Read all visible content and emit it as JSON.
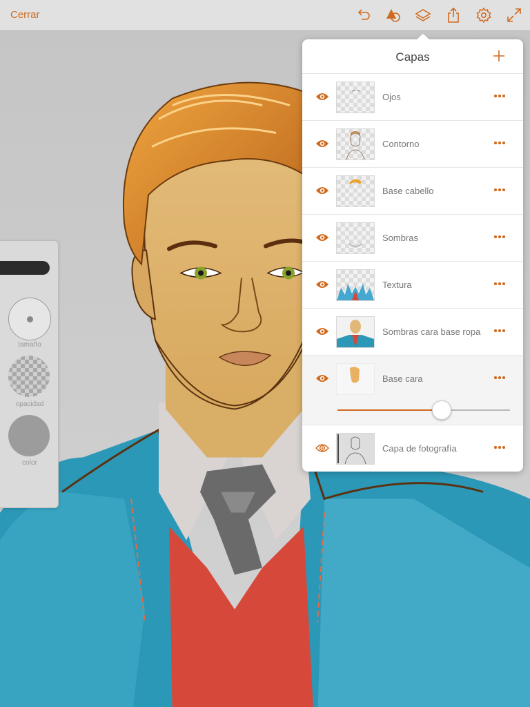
{
  "toolbar": {
    "close_label": "Cerrar",
    "icons": [
      "undo-icon",
      "shapes-icon",
      "layers-icon",
      "share-icon",
      "settings-icon",
      "expand-icon"
    ]
  },
  "brush_panel": {
    "size_label": "tamaño",
    "opacity_label": "opacidad",
    "color_label": "color"
  },
  "layers_panel": {
    "title": "Capas",
    "add_icon": "plus-icon",
    "layers": [
      {
        "name": "Ojos",
        "visible": true
      },
      {
        "name": "Contorno",
        "visible": true
      },
      {
        "name": "Base cabello",
        "visible": true
      },
      {
        "name": "Sombras",
        "visible": true
      },
      {
        "name": "Textura",
        "visible": true
      },
      {
        "name": "Sombras cara base ropa",
        "visible": true
      },
      {
        "name": "Base cara",
        "visible": true,
        "selected": true,
        "opacity": 0.6
      },
      {
        "name": "Capa de fotografía",
        "visible": true,
        "photo_layer": true
      }
    ]
  },
  "colors": {
    "accent": "#d06a1e",
    "toolbar_bg": "#e1e1e1",
    "canvas_bg": "#c9c9c9"
  }
}
